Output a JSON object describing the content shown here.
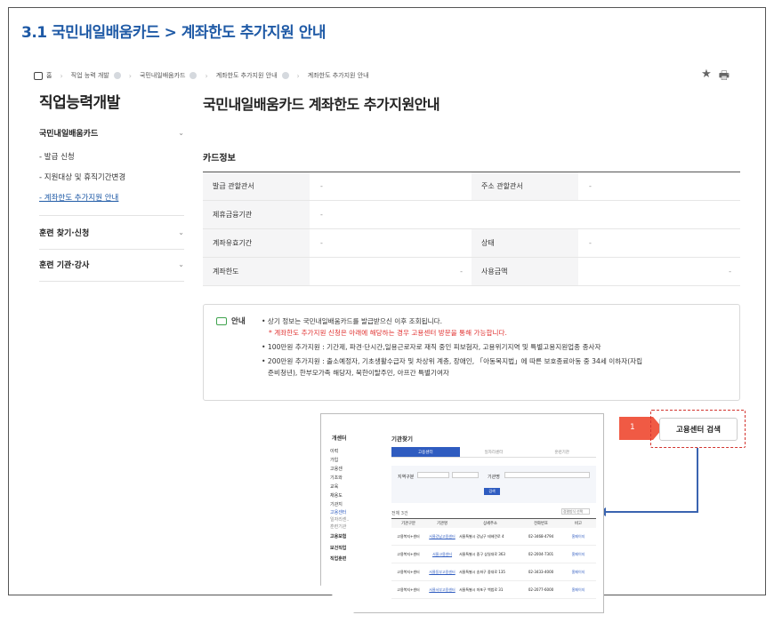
{
  "doc_title": "3.1 국민내일배움카드 > 계좌한도 추가지원 안내",
  "breadcrumb": {
    "home": "홈",
    "items": [
      "직업 능력 개발",
      "국민내일배움카드",
      "계좌한도 추가지원 안내",
      "계좌한도 추가지원 안내"
    ]
  },
  "tools": {
    "star_icon": "★",
    "print_icon": "🖶"
  },
  "sidebar": {
    "title": "직업능력개발",
    "groups": [
      {
        "label": "국민내일배움카드",
        "subs": [
          "- 발급 신청",
          "- 지원대상 및 휴직기간변경",
          "- 계좌한도 추가지원 안내"
        ]
      },
      {
        "label": "훈련 찾기·신청"
      },
      {
        "label": "훈련 기관·강사"
      }
    ],
    "chevron": "⌄"
  },
  "main": {
    "title": "국민내일배움카드 계좌한도 추가지원안내",
    "section": "카드정보",
    "rows": [
      {
        "l1": "발급 관할관서",
        "v1": "-",
        "l2": "주소 관할관서",
        "v2": "-"
      },
      {
        "l1": "제휴금융기관",
        "v1": "-"
      },
      {
        "l1": "계좌유효기간",
        "v1": "-",
        "l2": "상태",
        "v2": "-"
      },
      {
        "l1": "계좌한도",
        "v1": "-",
        "l2": "사용금액",
        "v2": "-"
      }
    ]
  },
  "notice": {
    "head": "안내",
    "line1": "• 상기 정보는 국민내일배움카드를 발급받으신 이후 조회됩니다.",
    "red": "* 계좌한도 추가지원 신청은 아래에 해당하는 경우 고용센터 방문을 통해 가능합니다.",
    "b1": "100만원 추가지원 : 기간제, 파견·단시간,일용근로자로 재직 중인 피보험자, 고용위기지역 및 특별고용지원업종 종사자",
    "b2a": "200만원 추가지원 : 출소예정자, 기초생활수급자 및 차상위 계층, 장애인, 「아동복지법」에 따른 보호종료아동 중 34세 이하자(자립",
    "b2b": "준비청년), 한부모가족 해당자, 북한이탈주민, 아프간 특별기여자"
  },
  "callout": {
    "number": "1",
    "button": "고용센터 검색",
    "tag_color": "#f05a44",
    "arrow_color": "#3a64b0"
  },
  "screenshot": {
    "side_title": "개센터",
    "page_title": "기관찾기",
    "tabs": [
      "고용센터",
      "일자리센터",
      "훈련기관"
    ],
    "side_items": [
      "이력",
      "가입",
      "고용센",
      "기초와",
      "교육",
      "채용도",
      "기관지",
      "고용센터",
      "일자리센..",
      "훈련기관",
      "고용보험",
      "보건직업",
      "직업훈련"
    ],
    "filter1": "지역구분",
    "filter2": "기관명",
    "search_btn": "검색",
    "count": "전체 3건",
    "sort": "정렬방식 선택",
    "cols": [
      "기관구분",
      "기관명",
      "상세주소",
      "전화번호",
      "비고"
    ],
    "rows": [
      {
        "a": "고용복지+센터",
        "b": "서울강남고용센터",
        "c": "서울특별시 강남구 테헤란로 4",
        "d": "02-3468-4794",
        "e": "홈페이지"
      },
      {
        "a": "고용복지+센터",
        "b": "서울고용센터",
        "c": "서울특별시 중구 삼일대로 363",
        "d": "02-2004-7301",
        "e": "홈페이지"
      },
      {
        "a": "고용복지+센터",
        "b": "서울동부고용센터",
        "c": "서울특별시 송파구 중대로 135",
        "d": "02-3433-4000",
        "e": "홈페이지"
      },
      {
        "a": "고용복지+센터",
        "b": "서울서부고용센터",
        "c": "서울특별시 마포구 백범로 31",
        "d": "02-2077-6000",
        "e": "홈페이지"
      }
    ]
  }
}
